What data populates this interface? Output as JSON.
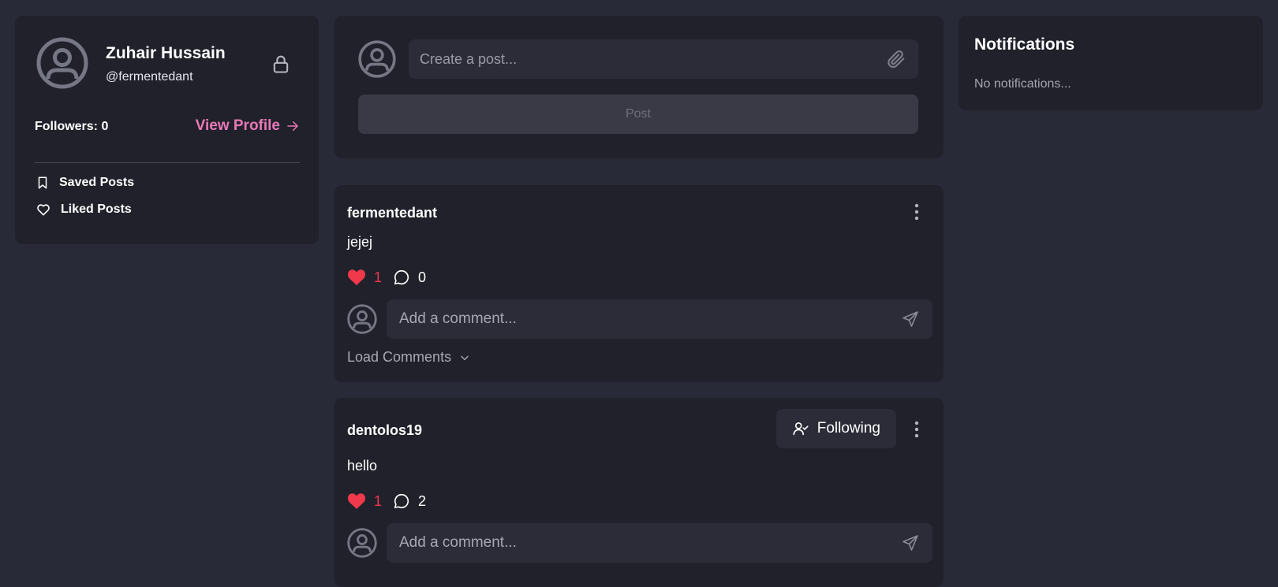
{
  "profile": {
    "name": "Zuhair Hussain",
    "handle": "@fermentedant",
    "followers_label": "Followers: 0",
    "view_profile_label": "View Profile",
    "menu": [
      {
        "label": "Saved Posts",
        "icon": "bookmark-icon"
      },
      {
        "label": "Liked Posts",
        "icon": "heart-outline-icon"
      }
    ]
  },
  "composer": {
    "placeholder": "Create a post...",
    "post_label": "Post"
  },
  "posts": [
    {
      "username": "fermentedant",
      "body": "jejej",
      "likes": "1",
      "comments": "0",
      "comment_placeholder": "Add a comment...",
      "load_comments_label": "Load Comments",
      "show_follow": false
    },
    {
      "username": "dentolos19",
      "body": "hello",
      "likes": "1",
      "comments": "2",
      "comment_placeholder": "Add a comment...",
      "following_label": "Following",
      "show_follow": true
    }
  ],
  "notifications": {
    "title": "Notifications",
    "empty_text": "No notifications..."
  },
  "colors": {
    "background": "#292a37",
    "card": "#20212b",
    "accent_pink": "#e879b5",
    "like_red": "#f0394a"
  }
}
